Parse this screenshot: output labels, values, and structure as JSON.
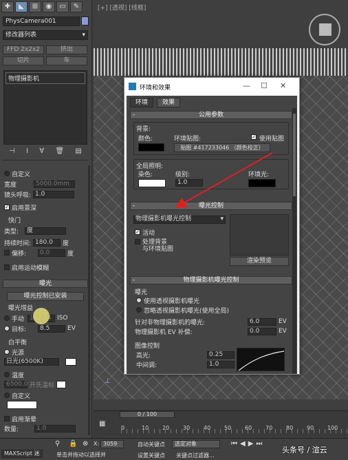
{
  "panel": {
    "object_name": "PhysCamera001",
    "modifier_list": "修改器列表",
    "btn_ffd": "FFD 2x2x2",
    "btn_extrude": "挤出",
    "btn_cut": "切片",
    "btn_turn": "车",
    "stack_item": "物理摄影机",
    "custom_label": "自定义",
    "film_width_label": "宽度",
    "film_width_value": "5000.0mm",
    "lens_breath_label": "镜头呼吸:",
    "lens_breath_value": "1.0",
    "enable_dof": "启用景深",
    "shutter_header": "快门",
    "type_label": "类型:",
    "type_value": "度",
    "duration_label": "持续时间:",
    "duration_value": "180.0",
    "duration_unit": "度",
    "offset_label": "偏移:",
    "offset_value": "0.0",
    "offset_unit": "度",
    "motion_blur": "启用运动模糊",
    "exposure_header": "曝光",
    "exposure_control_installed": "曝光控制已安装",
    "exposure_gain": "曝光增益",
    "manual_label": "手动",
    "manual_value": "162.14",
    "manual_unit": "ISO",
    "target_label": "目标:",
    "target_value": "8.5",
    "target_unit": "EV",
    "white_balance": "白平衡",
    "illuminant": "光源",
    "illuminant_value": "日光(6500K)",
    "temperature": "温度",
    "temp_value": "6500.0",
    "temp_unit": "开氏温标",
    "custom2": "自定义",
    "vignetting": "启用渐晕",
    "amount_label": "数量:",
    "amount_value": "1.0"
  },
  "viewport": {
    "label": "[+] [透视] [线框]"
  },
  "dialog": {
    "title": "环境和效果",
    "tab_env": "环境",
    "tab_effects": "效果",
    "common_params": "公用参数",
    "background": "背景:",
    "color_label": "颜色:",
    "env_map_label": "环境贴图:",
    "use_map": "使用贴图",
    "map_button": "贴图 #417233046 （颜色校正）",
    "global_lighting": "全局照明:",
    "tint_label": "染色:",
    "level_label": "级别:",
    "level_value": "1.0",
    "ambient_label": "环境光:",
    "exposure_control_header": "曝光控制",
    "exposure_dropdown": "物理摄影机曝光控制",
    "active": "活动",
    "process_bg_line1": "处理背景",
    "process_bg_line2": "与环境贴图",
    "render_preview": "渲染预览",
    "phys_exposure_header": "物理摄影机曝光控制",
    "exposure_section": "曝光",
    "use_camera_exposure": "使用透视摄影机曝光",
    "ignore_camera_exposure": "忽略透视摄影机曝光(使用全局)",
    "non_phys_label": "针对非物理摄影机的曝光:",
    "non_phys_value": "6.0",
    "non_phys_unit": "EV",
    "phys_comp_label": "物理摄影机 EV 补偿:",
    "phys_comp_value": "0.0",
    "phys_comp_unit": "EV",
    "image_control": "图像控制",
    "highlights_label": "高光:",
    "highlights_value": "0.25",
    "midtones_label": "中间调:",
    "midtones_value": "1.0"
  },
  "timeline": {
    "frame": "0 / 100",
    "ticks": [
      "0",
      "10",
      "20",
      "30",
      "40",
      "50",
      "60",
      "70",
      "80",
      "90",
      "100"
    ]
  },
  "status": {
    "maxscript": "MAXScript 迷",
    "prompt": "单击并拖动以选择并",
    "x_label": "X:",
    "x_value": "3059",
    "auto_key": "自动关键点",
    "selected": "选定对象",
    "set_key": "设置关键点",
    "key_filter": "关键点过滤器...",
    "watermark": "头条号 / 渲云"
  },
  "colors": {
    "dialog_bg": "#444444",
    "accent_arrow": "#e02020",
    "cursor": "#e6dc78"
  }
}
